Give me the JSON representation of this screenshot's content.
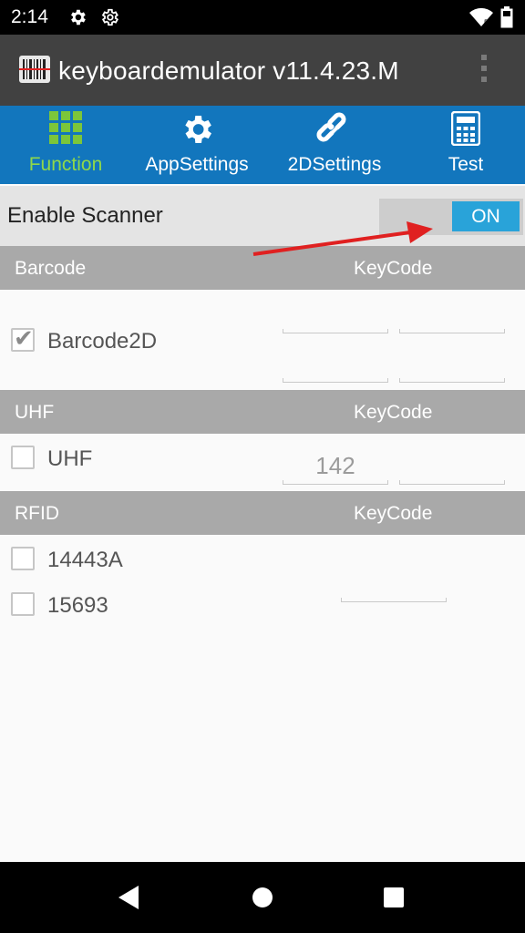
{
  "status_bar": {
    "time": "2:14",
    "icons": [
      "gear-icon",
      "gear-outline-icon",
      "wifi-icon",
      "battery-icon"
    ]
  },
  "app_bar": {
    "title": "keyboardemulator v11.4.23.M",
    "logo_icon": "barcode-scanner-icon",
    "menu_icon": "overflow-menu-icon"
  },
  "tabs": [
    {
      "label": "Function",
      "icon": "grid-icon",
      "active": true
    },
    {
      "label": "AppSettings",
      "icon": "gear-icon",
      "active": false
    },
    {
      "label": "2DSettings",
      "icon": "link-icon",
      "active": false
    },
    {
      "label": "Test",
      "icon": "calculator-icon",
      "active": false
    }
  ],
  "enable_scanner": {
    "label": "Enable Scanner",
    "toggle_label": "ON",
    "state": true
  },
  "barcode_section": {
    "header": "Barcode",
    "keycode_header": "KeyCode",
    "items": [
      {
        "label": "Barcode2D",
        "checked": true,
        "keycodes": [
          "",
          "",
          "",
          ""
        ]
      }
    ]
  },
  "uhf_section": {
    "header": "UHF",
    "keycode_header": "KeyCode",
    "items": [
      {
        "label": "UHF",
        "checked": false,
        "keycodes": [
          "142",
          ""
        ]
      }
    ]
  },
  "rfid_section": {
    "header": "RFID",
    "keycode_header": "KeyCode",
    "items": [
      {
        "label": "14443A",
        "checked": false
      },
      {
        "label": "15693",
        "checked": false,
        "keycode": ""
      }
    ]
  },
  "colors": {
    "tab_bar": "#1276bd",
    "active_tab": "#8fd84a",
    "toggle_on": "#29a3d9",
    "section_header": "#a9a9a9",
    "annotation_arrow": "#e02020"
  },
  "nav_bar": {
    "icons": [
      "back-icon",
      "home-icon",
      "recents-icon"
    ]
  }
}
